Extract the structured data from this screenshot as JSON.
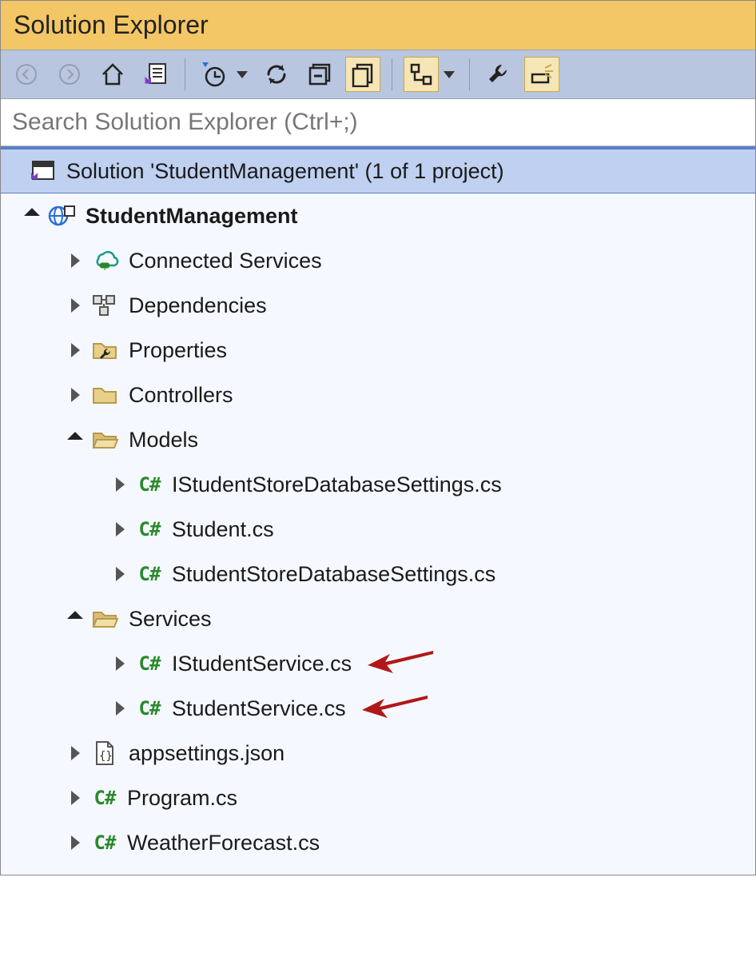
{
  "panel": {
    "title": "Solution Explorer"
  },
  "search": {
    "placeholder": "Search Solution Explorer (Ctrl+;)"
  },
  "tree": {
    "solution_label": "Solution 'StudentManagement' (1 of 1 project)",
    "project": "StudentManagement",
    "connected_services": "Connected Services",
    "dependencies": "Dependencies",
    "properties": "Properties",
    "controllers": "Controllers",
    "models": "Models",
    "model_items": {
      "istudentstoredb": "IStudentStoreDatabaseSettings.cs",
      "student": "Student.cs",
      "studentstoredb": "StudentStoreDatabaseSettings.cs"
    },
    "services": "Services",
    "service_items": {
      "istudentservice": "IStudentService.cs",
      "studentservice": "StudentService.cs"
    },
    "appsettings": "appsettings.json",
    "program": "Program.cs",
    "weatherforecast": "WeatherForecast.cs"
  }
}
